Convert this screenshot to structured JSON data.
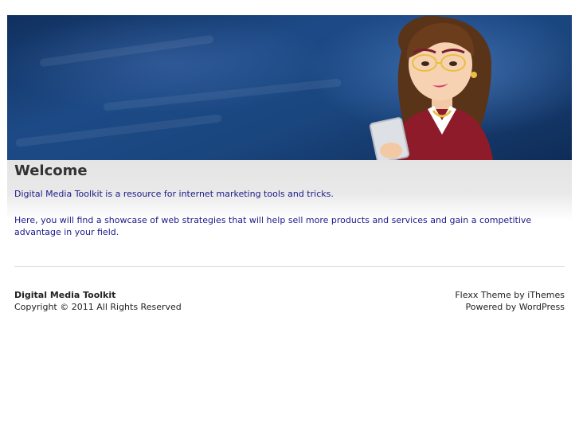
{
  "header": {
    "banner_image": "cartoon-businesswoman-with-tablet",
    "colors": {
      "banner_base": "#1d4a86",
      "banner_dark": "#0f2c57"
    }
  },
  "main": {
    "title": "Welcome",
    "paragraphs": [
      "Digital Media Toolkit is a resource for internet marketing tools and tricks.",
      "Here, you will find a showcase of web strategies that will help sell more products and services and gain a competitive advantage in your field."
    ],
    "text_color": "#1b1b8a"
  },
  "footer": {
    "site_name": "Digital Media Toolkit",
    "copyright": "Copyright © 2011 All Rights Reserved",
    "theme_credit": "Flexx Theme by iThemes",
    "powered_by": "Powered by WordPress"
  }
}
